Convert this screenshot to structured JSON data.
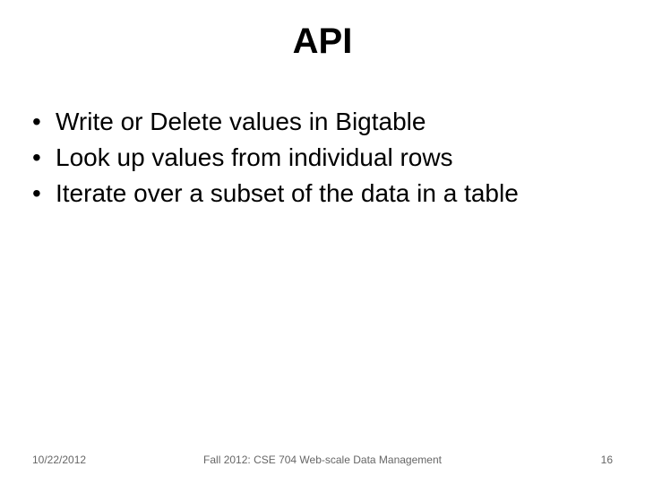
{
  "title": "API",
  "bullets": [
    "Write or Delete values in Bigtable",
    "Look up values from individual rows",
    "Iterate over a subset of the data in a table"
  ],
  "footer": {
    "date": "10/22/2012",
    "center": "Fall 2012: CSE 704 Web-scale Data Management",
    "page": "16"
  }
}
